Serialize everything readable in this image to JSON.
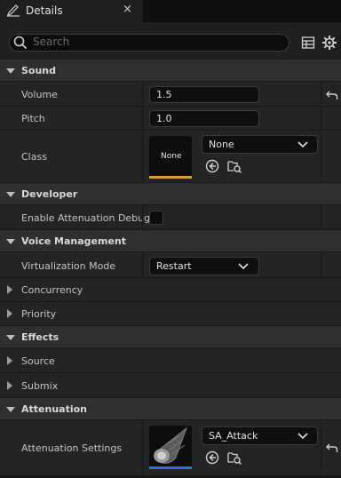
{
  "tab": {
    "title": "Details",
    "close_glyph": "×",
    "icon": "details-pencil-icon"
  },
  "search": {
    "placeholder": "Search",
    "value": ""
  },
  "toolbar_icons": [
    "table-view-icon",
    "gear-icon"
  ],
  "sections": {
    "sound": {
      "label": "Sound",
      "volume": {
        "label": "Volume",
        "value": "1.5"
      },
      "pitch": {
        "label": "Pitch",
        "value": "1.0"
      },
      "class": {
        "label": "Class",
        "thumbnail_text": "None",
        "selected": "None"
      }
    },
    "developer": {
      "label": "Developer",
      "enable_attenuation_debug": {
        "label": "Enable Attenuation Debug",
        "checked": false
      }
    },
    "voice_management": {
      "label": "Voice Management",
      "virtualization_mode": {
        "label": "Virtualization Mode",
        "selected": "Restart"
      },
      "concurrency": {
        "label": "Concurrency"
      },
      "priority": {
        "label": "Priority"
      }
    },
    "effects": {
      "label": "Effects",
      "source": {
        "label": "Source"
      },
      "submix": {
        "label": "Submix"
      }
    },
    "attenuation": {
      "label": "Attenuation",
      "attenuation_settings": {
        "label": "Attenuation Settings",
        "selected": "SA_Attack"
      }
    }
  },
  "colors": {
    "class_thumbnail_underline": "#d99b2e",
    "attenuation_thumbnail_underline": "#2f6fd6"
  }
}
